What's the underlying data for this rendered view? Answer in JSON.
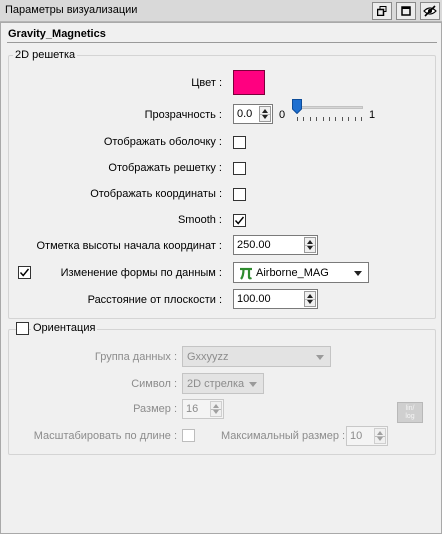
{
  "window": {
    "title": "Параметры визуализации",
    "buttons": [
      {
        "icon": "restore-windows-icon"
      },
      {
        "icon": "maximize-icon"
      },
      {
        "icon": "eye-off-icon"
      }
    ]
  },
  "object_name": "Gravity_Magnetics",
  "grid_group": {
    "legend": "2D решетка",
    "color_label": "Цвет :",
    "color_value": "#ff0080",
    "transparency_label": "Прозрачность :",
    "transparency_value": "0.0",
    "slider_min": "0",
    "slider_max": "1",
    "slider_position": 0.0,
    "show_shell_label": "Отображать оболочку :",
    "show_shell_checked": false,
    "show_grid_label": "Отображать решетку :",
    "show_grid_checked": false,
    "show_coords_label": "Отображать координаты :",
    "show_coords_checked": false,
    "smooth_label": "Smooth :",
    "smooth_checked": true,
    "height_mark_label": "Отметка высоты начала координат :",
    "height_mark_value": "250.00",
    "reshape_enabled_checked": true,
    "reshape_label": "Изменение формы по данным :",
    "reshape_value": "Airborne_MAG",
    "reshape_icon": "pi-icon",
    "distance_label": "Расстояние от плоскости :",
    "distance_value": "100.00"
  },
  "orientation_group": {
    "legend": "Ориентация",
    "enabled": false,
    "data_group_label": "Группа данных :",
    "data_group_value": "Gxxyyzz",
    "symbol_label": "Символ :",
    "symbol_value": "2D стрелка",
    "size_label": "Размер :",
    "size_value": "16",
    "scale_by_length_label": "Масштабировать по длине :",
    "scale_by_length_checked": false,
    "max_size_label": "Максимальный размер :",
    "max_size_value": "10",
    "lin_log_button": "lin/\nlog"
  },
  "colors": {
    "accent": "#ff0080",
    "slider_thumb": "#1e6fd0",
    "pi_icon": "#2e8b2e"
  }
}
